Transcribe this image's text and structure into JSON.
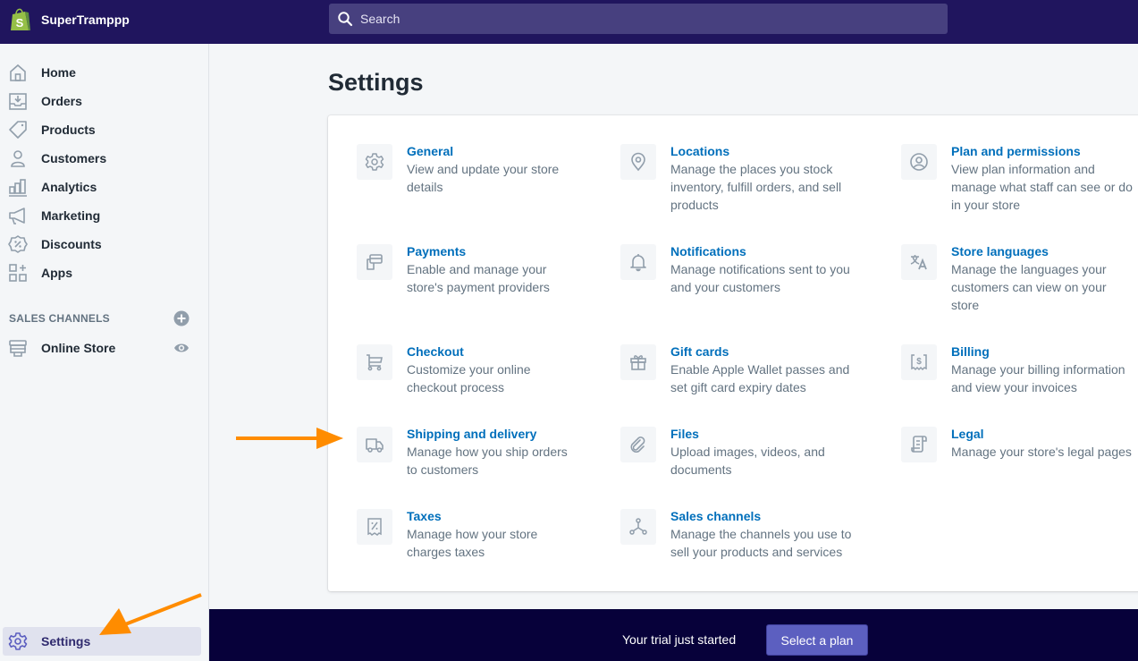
{
  "topbar": {
    "store_name": "SuperTramppp",
    "search_placeholder": "Search"
  },
  "sidebar": {
    "items": [
      {
        "label": "Home",
        "icon": "home-icon"
      },
      {
        "label": "Orders",
        "icon": "orders-icon"
      },
      {
        "label": "Products",
        "icon": "tag-icon"
      },
      {
        "label": "Customers",
        "icon": "person-icon"
      },
      {
        "label": "Analytics",
        "icon": "bar-chart-icon"
      },
      {
        "label": "Marketing",
        "icon": "megaphone-icon"
      },
      {
        "label": "Discounts",
        "icon": "discount-icon"
      },
      {
        "label": "Apps",
        "icon": "apps-icon"
      }
    ],
    "sales_channels_title": "SALES CHANNELS",
    "channels": [
      {
        "label": "Online Store",
        "icon": "store-icon"
      }
    ],
    "settings_label": "Settings"
  },
  "main": {
    "title": "Settings",
    "settings": [
      {
        "title": "General",
        "desc": [
          "View and update your store",
          "details"
        ],
        "icon": "gear-icon"
      },
      {
        "title": "Locations",
        "desc": [
          "Manage the places you stock",
          "inventory, fulfill orders, and sell",
          "products"
        ],
        "icon": "location-pin-icon"
      },
      {
        "title": "Plan and permissions",
        "desc": [
          "View plan information and",
          "manage what staff can see or do",
          "in your store"
        ],
        "icon": "user-circle-icon"
      },
      {
        "title": "Payments",
        "desc": [
          "Enable and manage your",
          "store's payment providers"
        ],
        "icon": "payments-icon"
      },
      {
        "title": "Notifications",
        "desc": [
          "Manage notifications sent to you",
          "and your customers"
        ],
        "icon": "bell-icon"
      },
      {
        "title": "Store languages",
        "desc": [
          "Manage the languages your",
          "customers can view on your",
          "store"
        ],
        "icon": "translate-icon"
      },
      {
        "title": "Checkout",
        "desc": [
          "Customize your online",
          "checkout process"
        ],
        "icon": "cart-icon"
      },
      {
        "title": "Gift cards",
        "desc": [
          "Enable Apple Wallet passes and",
          "set gift card expiry dates"
        ],
        "icon": "gift-icon"
      },
      {
        "title": "Billing",
        "desc": [
          "Manage your billing information",
          "and view your invoices"
        ],
        "icon": "billing-icon"
      },
      {
        "title": "Shipping and delivery",
        "desc": [
          "Manage how you ship orders",
          "to customers"
        ],
        "icon": "truck-icon"
      },
      {
        "title": "Files",
        "desc": [
          "Upload images, videos, and",
          "documents"
        ],
        "icon": "paperclip-icon"
      },
      {
        "title": "Legal",
        "desc": [
          "Manage your store's legal pages"
        ],
        "icon": "legal-scroll-icon"
      },
      {
        "title": "Taxes",
        "desc": [
          "Manage how your store",
          "charges taxes"
        ],
        "icon": "tax-receipt-icon"
      },
      {
        "title": "Sales channels",
        "desc": [
          "Manage the channels you use to",
          "sell your products and services"
        ],
        "icon": "channels-icon"
      }
    ]
  },
  "trial": {
    "text": "Your trial just started",
    "button_label": "Select a plan"
  },
  "colors": {
    "topbar": "#20155e",
    "link": "#006fbb",
    "trial_bar": "#07013a",
    "plan_button": "#5c5fc0",
    "annotation_arrow": "#ff8c00"
  }
}
